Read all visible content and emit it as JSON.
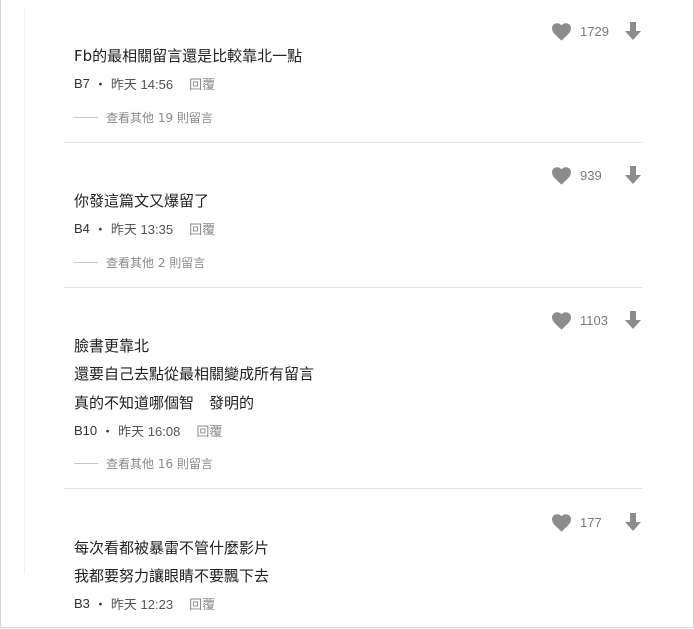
{
  "comments": [
    {
      "lines": [
        "Fb的最相關留言還是比較靠北一點"
      ],
      "floor": "B7",
      "time": "昨天 14:56",
      "reply_label": "回覆",
      "likes": "1729",
      "more_replies": "查看其他 19 則留言"
    },
    {
      "lines": [
        "你發這篇文又爆留了"
      ],
      "floor": "B4",
      "time": "昨天 13:35",
      "reply_label": "回覆",
      "likes": "939",
      "more_replies": "查看其他 2 則留言"
    },
    {
      "lines": [
        "臉書更靠北",
        "還要自己去點從最相關變成所有留言",
        "真的不知道哪個智　發明的"
      ],
      "floor": "B10",
      "time": "昨天 16:08",
      "reply_label": "回覆",
      "likes": "1103",
      "more_replies": "查看其他 16 則留言"
    },
    {
      "lines": [
        "每次看都被暴雷不管什麼影片",
        "我都要努力讓眼睛不要飄下去"
      ],
      "floor": "B3",
      "time": "昨天 12:23",
      "reply_label": "回覆",
      "likes": "177"
    }
  ],
  "colors": {
    "icon": "#8c8c8c",
    "divider": "#e3e3e3",
    "text": "#222222",
    "muted": "#8a8a8a"
  },
  "icons": {
    "like": "heart-icon",
    "downvote": "arrow-down-icon"
  },
  "meta_separator": "・"
}
